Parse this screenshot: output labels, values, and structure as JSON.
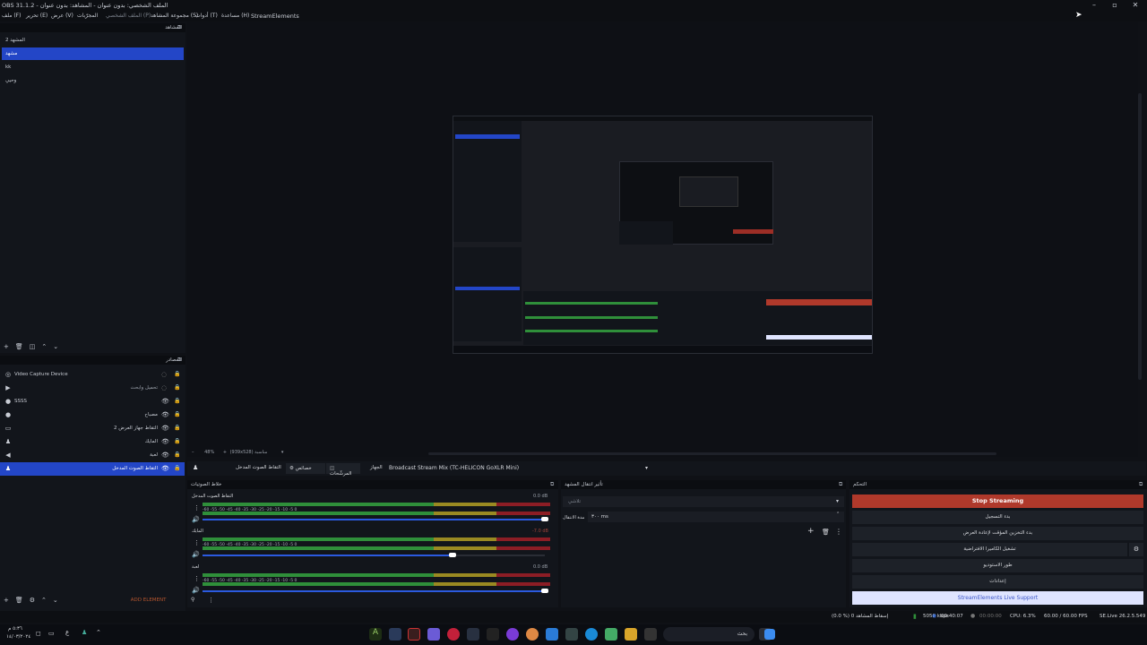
{
  "window": {
    "title": "OBS 31.1.2 - الملف الشخصي: بدون عنوان - المشاهد: بدون عنوان",
    "minimize": "–",
    "maximize": "▫",
    "close": "✕"
  },
  "menubar": {
    "items": [
      "ملف (F)",
      "تحرير (E)",
      "عرض (V)",
      "المجرّبات",
      "الملف الشخصي (P)",
      "مجموعة المشاهد (S)",
      "أدوات (T)",
      "مساعدة (H)",
      "StreamElements"
    ]
  },
  "scenes": {
    "header": "المشاهد",
    "items": [
      "المشهد 2",
      "مشهد",
      "kk",
      "وحيي"
    ],
    "selected_index": 1
  },
  "sources": {
    "header": "المصادر",
    "items": [
      {
        "label": "Video Capture Device",
        "align": "left",
        "icon": "camera-icon"
      },
      {
        "label": "تحميل وابحث",
        "align": "right",
        "icon": "play-icon"
      },
      {
        "label": "SSSS",
        "align": "left",
        "icon": "globe-icon"
      },
      {
        "label": "مصباح",
        "align": "right",
        "icon": "globe-icon"
      },
      {
        "label": "التقاط جهاز العرض 2",
        "align": "right",
        "icon": "monitor-icon"
      },
      {
        "label": "المايك",
        "align": "right",
        "icon": "mic-icon"
      },
      {
        "label": "لعبة",
        "align": "right",
        "icon": "speaker-icon"
      },
      {
        "label": "التقاط الصوت المدخل",
        "align": "right",
        "icon": "mic-icon"
      }
    ],
    "add_element": "ADD ELEMENT"
  },
  "preview": {
    "zoom": "48%",
    "resolution": "(939x528) مناسبة"
  },
  "audio_source_bar": {
    "source": "التقاط الصوت المدخل",
    "properties": "خصائص",
    "filters": "المرشّحات",
    "device_label": "الجهاز",
    "device_value": "Broadcast Stream Mix (TC-HELICON GoXLR Mini)"
  },
  "mixer": {
    "header": "خلاط الصوتيات",
    "ticks": "-60  -55  -50  -45  -40  -35  -30  -25  -20  -15  -10  -5  0",
    "channels": [
      {
        "name": "التقاط الصوت المدخل",
        "db": "0.0 dB",
        "level": 0.98
      },
      {
        "name": "المايك",
        "db": "-7.0 dB",
        "level": 0.72
      },
      {
        "name": "لعبة",
        "db": "0.0 dB",
        "level": 0.98
      }
    ]
  },
  "transitions": {
    "header": "تأثير انتقال المشهد",
    "type": "تلاشي",
    "duration_label": "مدة الانتقال",
    "duration_value": "٣٠٠ ms"
  },
  "controls": {
    "header": "التحكم",
    "stop_streaming": "Stop Streaming",
    "start_recording": "بدء التسجيل",
    "replay_buffer": "بدء التخزين المؤقت لإعادة العرض",
    "virtual_camera": "تشغيل الكاميرا الافتراضية",
    "studio_mode": "طور الاستوديو",
    "settings": "إعدادات",
    "support": "StreamElements Live Support"
  },
  "statusbar": {
    "dropped": "(0.0 %) إسقاط المشاهد 0",
    "bitrate": "5050 kbps",
    "live_time": "00:40:07",
    "rec_time": "00:00:00",
    "cpu": "CPU: 6.3%",
    "fps": "60.00 / 60.00 FPS",
    "version": "SE.Live 26.2.5.549"
  },
  "taskbar": {
    "time": "٥:٣٦ م",
    "date": "١٤/٠٣/٢٠٢٤",
    "lang": "ع",
    "search": "بحث"
  },
  "colors": {
    "accent": "#2346c7",
    "stop": "#b0392b",
    "support": "#dfe4ff"
  }
}
